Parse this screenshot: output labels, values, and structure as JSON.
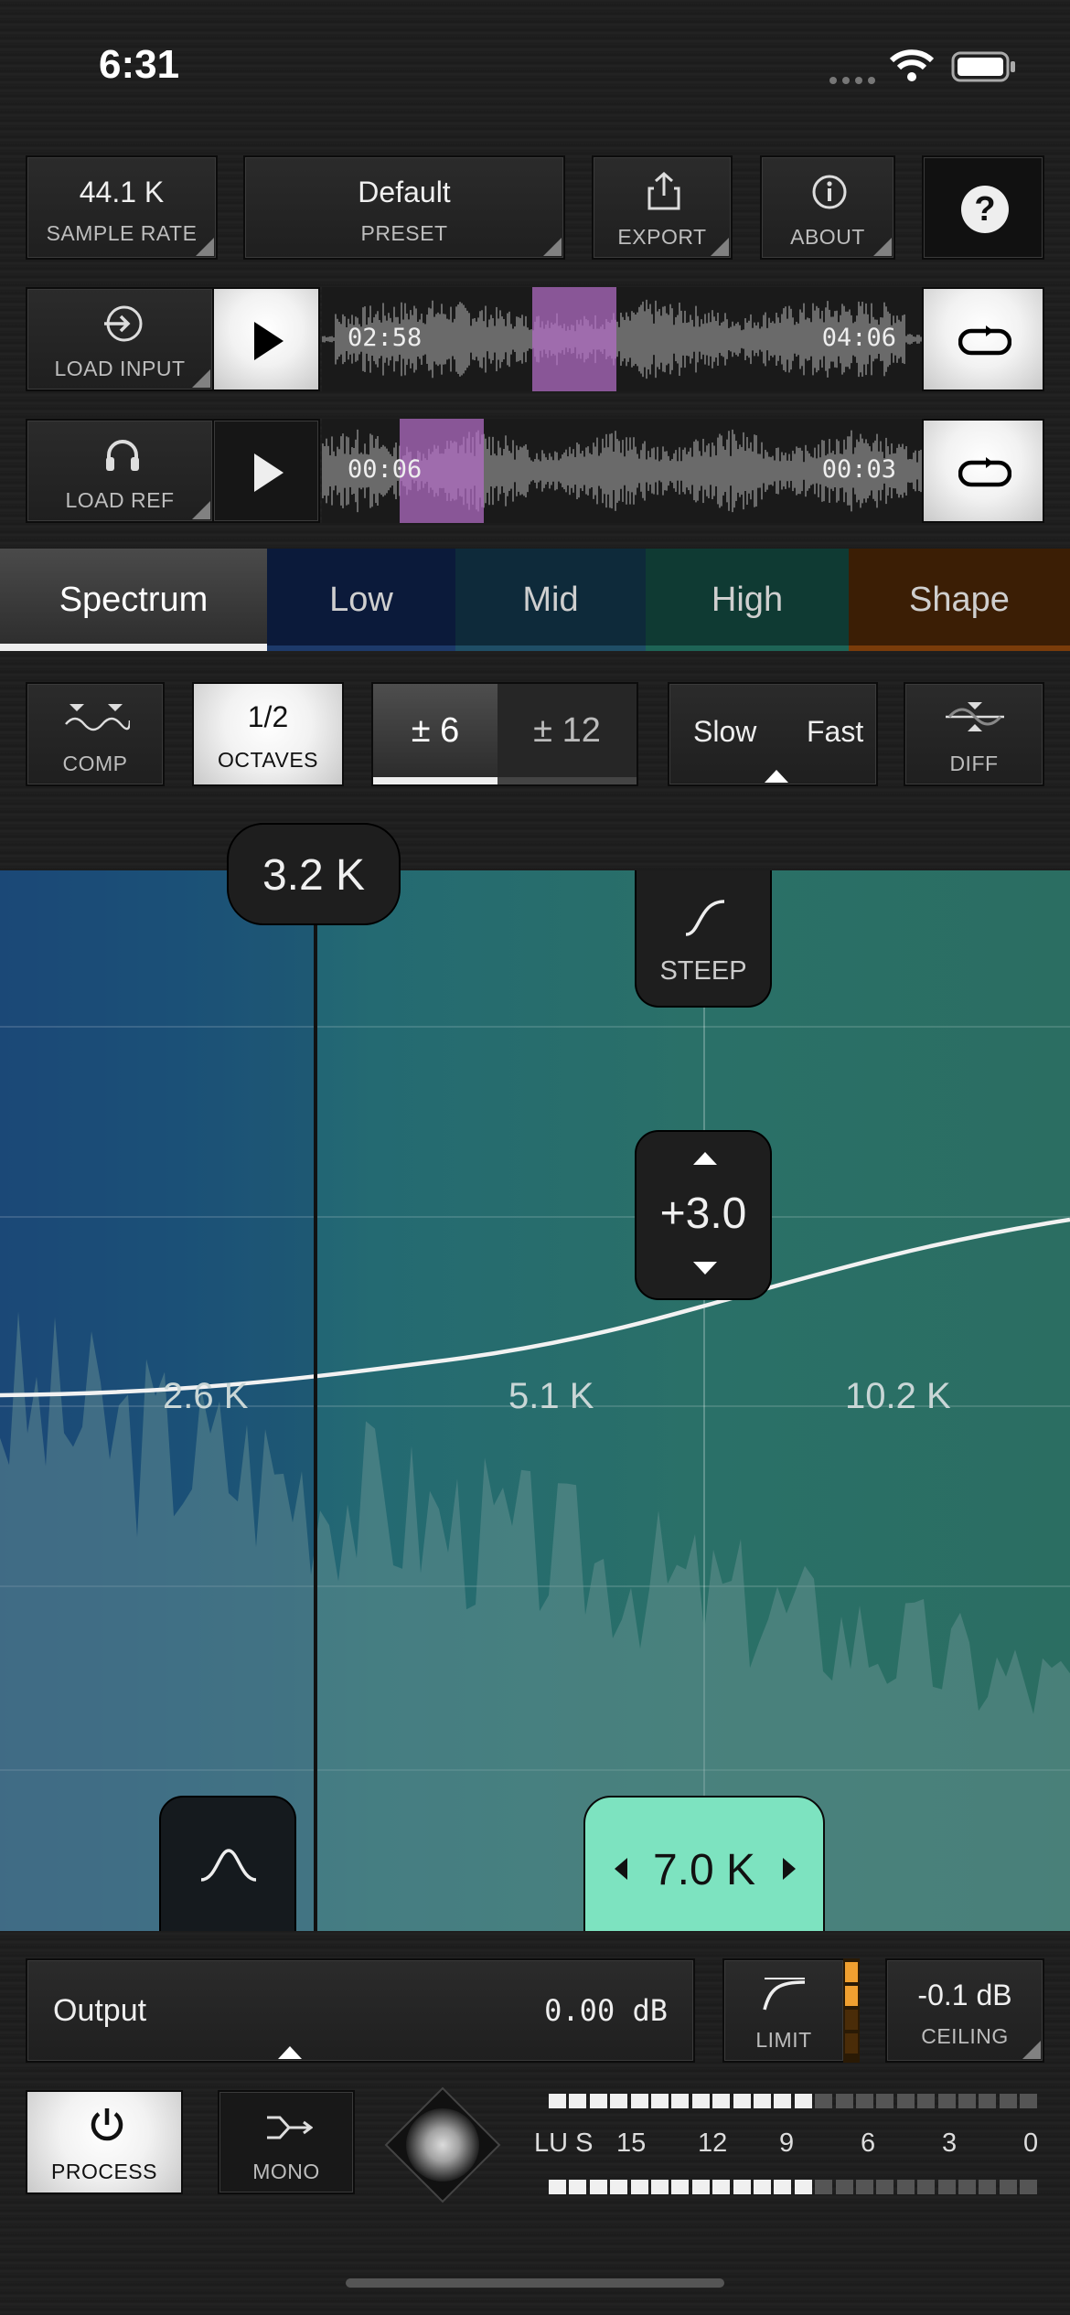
{
  "status_bar": {
    "time": "6:31"
  },
  "top_buttons": {
    "sample_rate": {
      "value": "44.1 K",
      "label": "SAMPLE RATE"
    },
    "preset": {
      "value": "Default",
      "label": "PRESET"
    },
    "export": {
      "label": "EXPORT",
      "icon": "share-icon"
    },
    "about": {
      "label": "ABOUT",
      "icon": "info-icon"
    },
    "help": {
      "label": "?"
    }
  },
  "input_track": {
    "load_label": "LOAD INPUT",
    "time_left": "02:58",
    "time_right": "04:06",
    "loop_position": 0.35
  },
  "ref_track": {
    "load_label": "LOAD REF",
    "time_left": "00:06",
    "time_right": "00:03",
    "loop_position": 0.13
  },
  "tabs": [
    "Spectrum",
    "Low",
    "Mid",
    "High",
    "Shape"
  ],
  "active_tab": "Spectrum",
  "tab_colors": {
    "low": "#0b1a3a",
    "mid": "#0e2a3a",
    "high": "#0f3a33",
    "shape": "#3b1e05"
  },
  "controls": {
    "comp": {
      "label": "COMP"
    },
    "octaves": {
      "value": "1/2",
      "label": "OCTAVES"
    },
    "range": {
      "options": [
        "± 6",
        "± 12"
      ],
      "selected": "± 6"
    },
    "speed": {
      "options": [
        "Slow",
        "Fast"
      ],
      "selected": "Fast"
    },
    "diff": {
      "label": "DIFF"
    }
  },
  "eq_view": {
    "crossover_freq": "3.2 K",
    "steep_label": "STEEP",
    "gain_value": "+3.0",
    "freq_labels": [
      "2.6 K",
      "5.1 K",
      "10.2 K"
    ],
    "band_freq": "7.0 K",
    "band_color": "#7de3c0"
  },
  "output": {
    "label": "Output",
    "value": "0.00",
    "unit": "dB"
  },
  "limit": {
    "label": "LIMIT"
  },
  "ceiling": {
    "value": "-0.1 dB",
    "label": "CEILING"
  },
  "bottom": {
    "process_label": "PROCESS",
    "mono_label": "MONO",
    "lus_label": "LU S",
    "meter_scale": [
      "15",
      "12",
      "9",
      "6",
      "3",
      "0"
    ]
  }
}
